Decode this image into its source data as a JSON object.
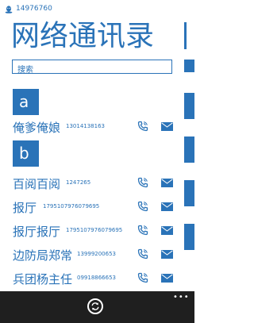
{
  "status": {
    "account_id": "14976760"
  },
  "app": {
    "title": "网络通讯录"
  },
  "search": {
    "placeholder": "搜索"
  },
  "groups": [
    {
      "letter": "a"
    },
    {
      "letter": "b"
    }
  ],
  "contacts": [
    {
      "name": "俺爹俺娘",
      "phone": "13014138163"
    },
    {
      "name": "百阅百阅",
      "phone": "1247265"
    },
    {
      "name": "报厅",
      "phone": "1795107976079695"
    },
    {
      "name": "报厅报厅",
      "phone": "1795107976079695"
    },
    {
      "name": "边防局郑常",
      "phone": "13999200653"
    },
    {
      "name": "兵团杨主任",
      "phone": "09918866653"
    }
  ],
  "icons": {
    "status": "qq-penguin-icon",
    "call": "phone-call-icon",
    "sms": "envelope-icon",
    "app_bar": [
      "sync-icon",
      "more-options-icon"
    ]
  },
  "colors": {
    "accent": "#2a73b8",
    "app_bar": "#1f1f1f",
    "background": "#ffffff"
  }
}
